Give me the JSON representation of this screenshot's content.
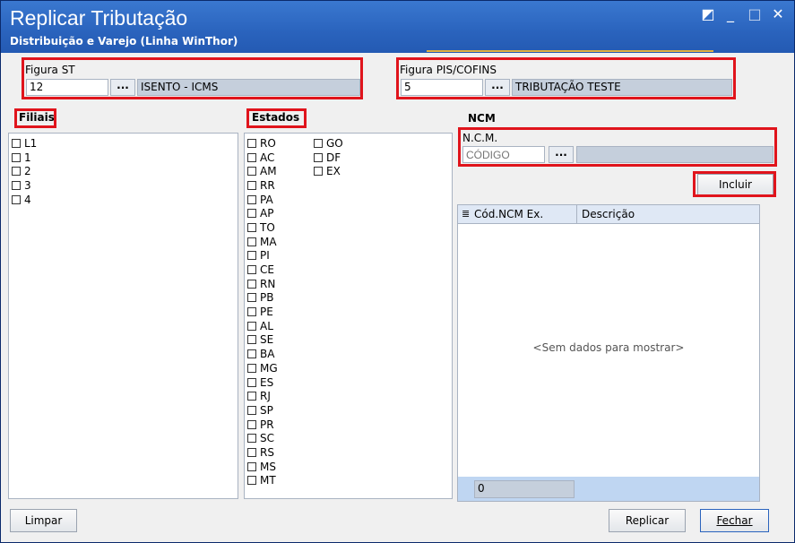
{
  "window": {
    "title": "Replicar Tributação",
    "subtitle": "Distribuição e Varejo (Linha WinThor)",
    "controls": [
      "◩",
      "_",
      "□",
      "✕"
    ]
  },
  "figura_st": {
    "label": "Figura ST",
    "code": "12",
    "lookup": "...",
    "description": "ISENTO - ICMS"
  },
  "figura_pis": {
    "label": "Figura PIS/COFINS",
    "code": "5",
    "lookup": "...",
    "description": "TRIBUTAÇÃO TESTE"
  },
  "filiais": {
    "title": "Filiais",
    "items": [
      "L1",
      "1",
      "2",
      "3",
      "4"
    ]
  },
  "estados": {
    "title": "Estados",
    "col1": [
      "RO",
      "AC",
      "AM",
      "RR",
      "PA",
      "AP",
      "TO",
      "MA",
      "PI",
      "CE",
      "RN",
      "PB",
      "PE",
      "AL",
      "SE",
      "BA",
      "MG",
      "ES",
      "RJ",
      "SP",
      "PR",
      "SC",
      "RS",
      "MS",
      "MT"
    ],
    "col2": [
      "GO",
      "DF",
      "EX"
    ]
  },
  "ncm": {
    "title": "NCM",
    "field_label": "N.C.M.",
    "placeholder": "CÓDIGO",
    "lookup": "...",
    "include_button": "Incluir",
    "grid": {
      "columns": [
        "Cód.NCM Ex.",
        "Descrição"
      ],
      "empty_text": "<Sem dados para mostrar>",
      "footer_count": "0"
    }
  },
  "footer": {
    "clear": "Limpar",
    "replicate": "Replicar",
    "close": "Fechar"
  }
}
